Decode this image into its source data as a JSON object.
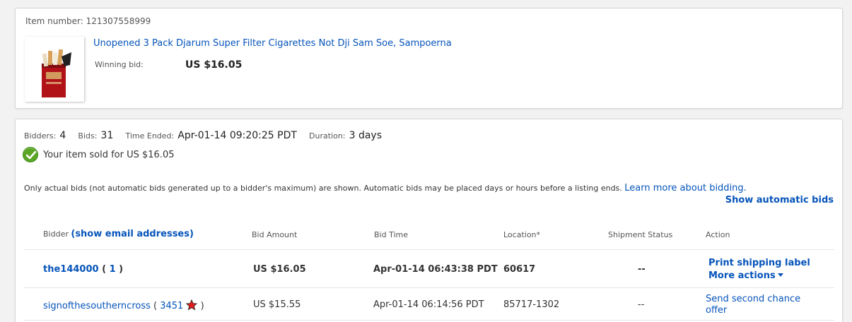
{
  "item": {
    "number_text": "Item number: 121307558999",
    "title": "Unopened 3 Pack Djarum Super Filter Cigarettes Not Dji Sam Soe, Sampoerna",
    "winning_label": "Winning bid:",
    "winning_value": "US $16.05"
  },
  "summary": {
    "bidders_label": "Bidders:",
    "bidders_value": "4",
    "bids_label": "Bids:",
    "bids_value": "31",
    "time_ended_label": "Time Ended:",
    "time_ended_value": "Apr-01-14 09:20:25 PDT",
    "duration_label": "Duration:",
    "duration_value": "3 days",
    "sold_text": "Your item sold for US $16.05"
  },
  "note": {
    "text": "Only actual bids (not automatic bids generated up to a bidder's maximum) are shown. Automatic bids may be placed days or hours before a listing ends.",
    "learn_more": "Learn more about bidding.",
    "show_automatic": "Show automatic bids"
  },
  "table": {
    "headers": {
      "bidder": "Bidder",
      "show_email": "show email addresses",
      "amount": "Bid Amount",
      "time": "Bid Time",
      "location": "Location*",
      "shipment": "Shipment Status",
      "action": "Action"
    },
    "rows": [
      {
        "bidder": "the144000",
        "feedback": "1",
        "amount": "US $16.05",
        "time": "Apr-01-14 06:43:38 PDT",
        "location": "60617",
        "shipment": "--",
        "action1": "Print shipping label",
        "action2": "More actions"
      },
      {
        "bidder": "signofthesoutherncross",
        "feedback": "3451",
        "amount": "US $15.55",
        "time": "Apr-01-14 06:14:56 PDT",
        "location": "85717-1302",
        "shipment": "--",
        "action1": "Send second chance offer"
      }
    ]
  },
  "colors": {
    "link": "#0654ba",
    "sold_green": "#5ba525",
    "star_red": "#e01b1b"
  },
  "icons": [
    "check-icon",
    "star-icon",
    "caret-down-icon"
  ]
}
